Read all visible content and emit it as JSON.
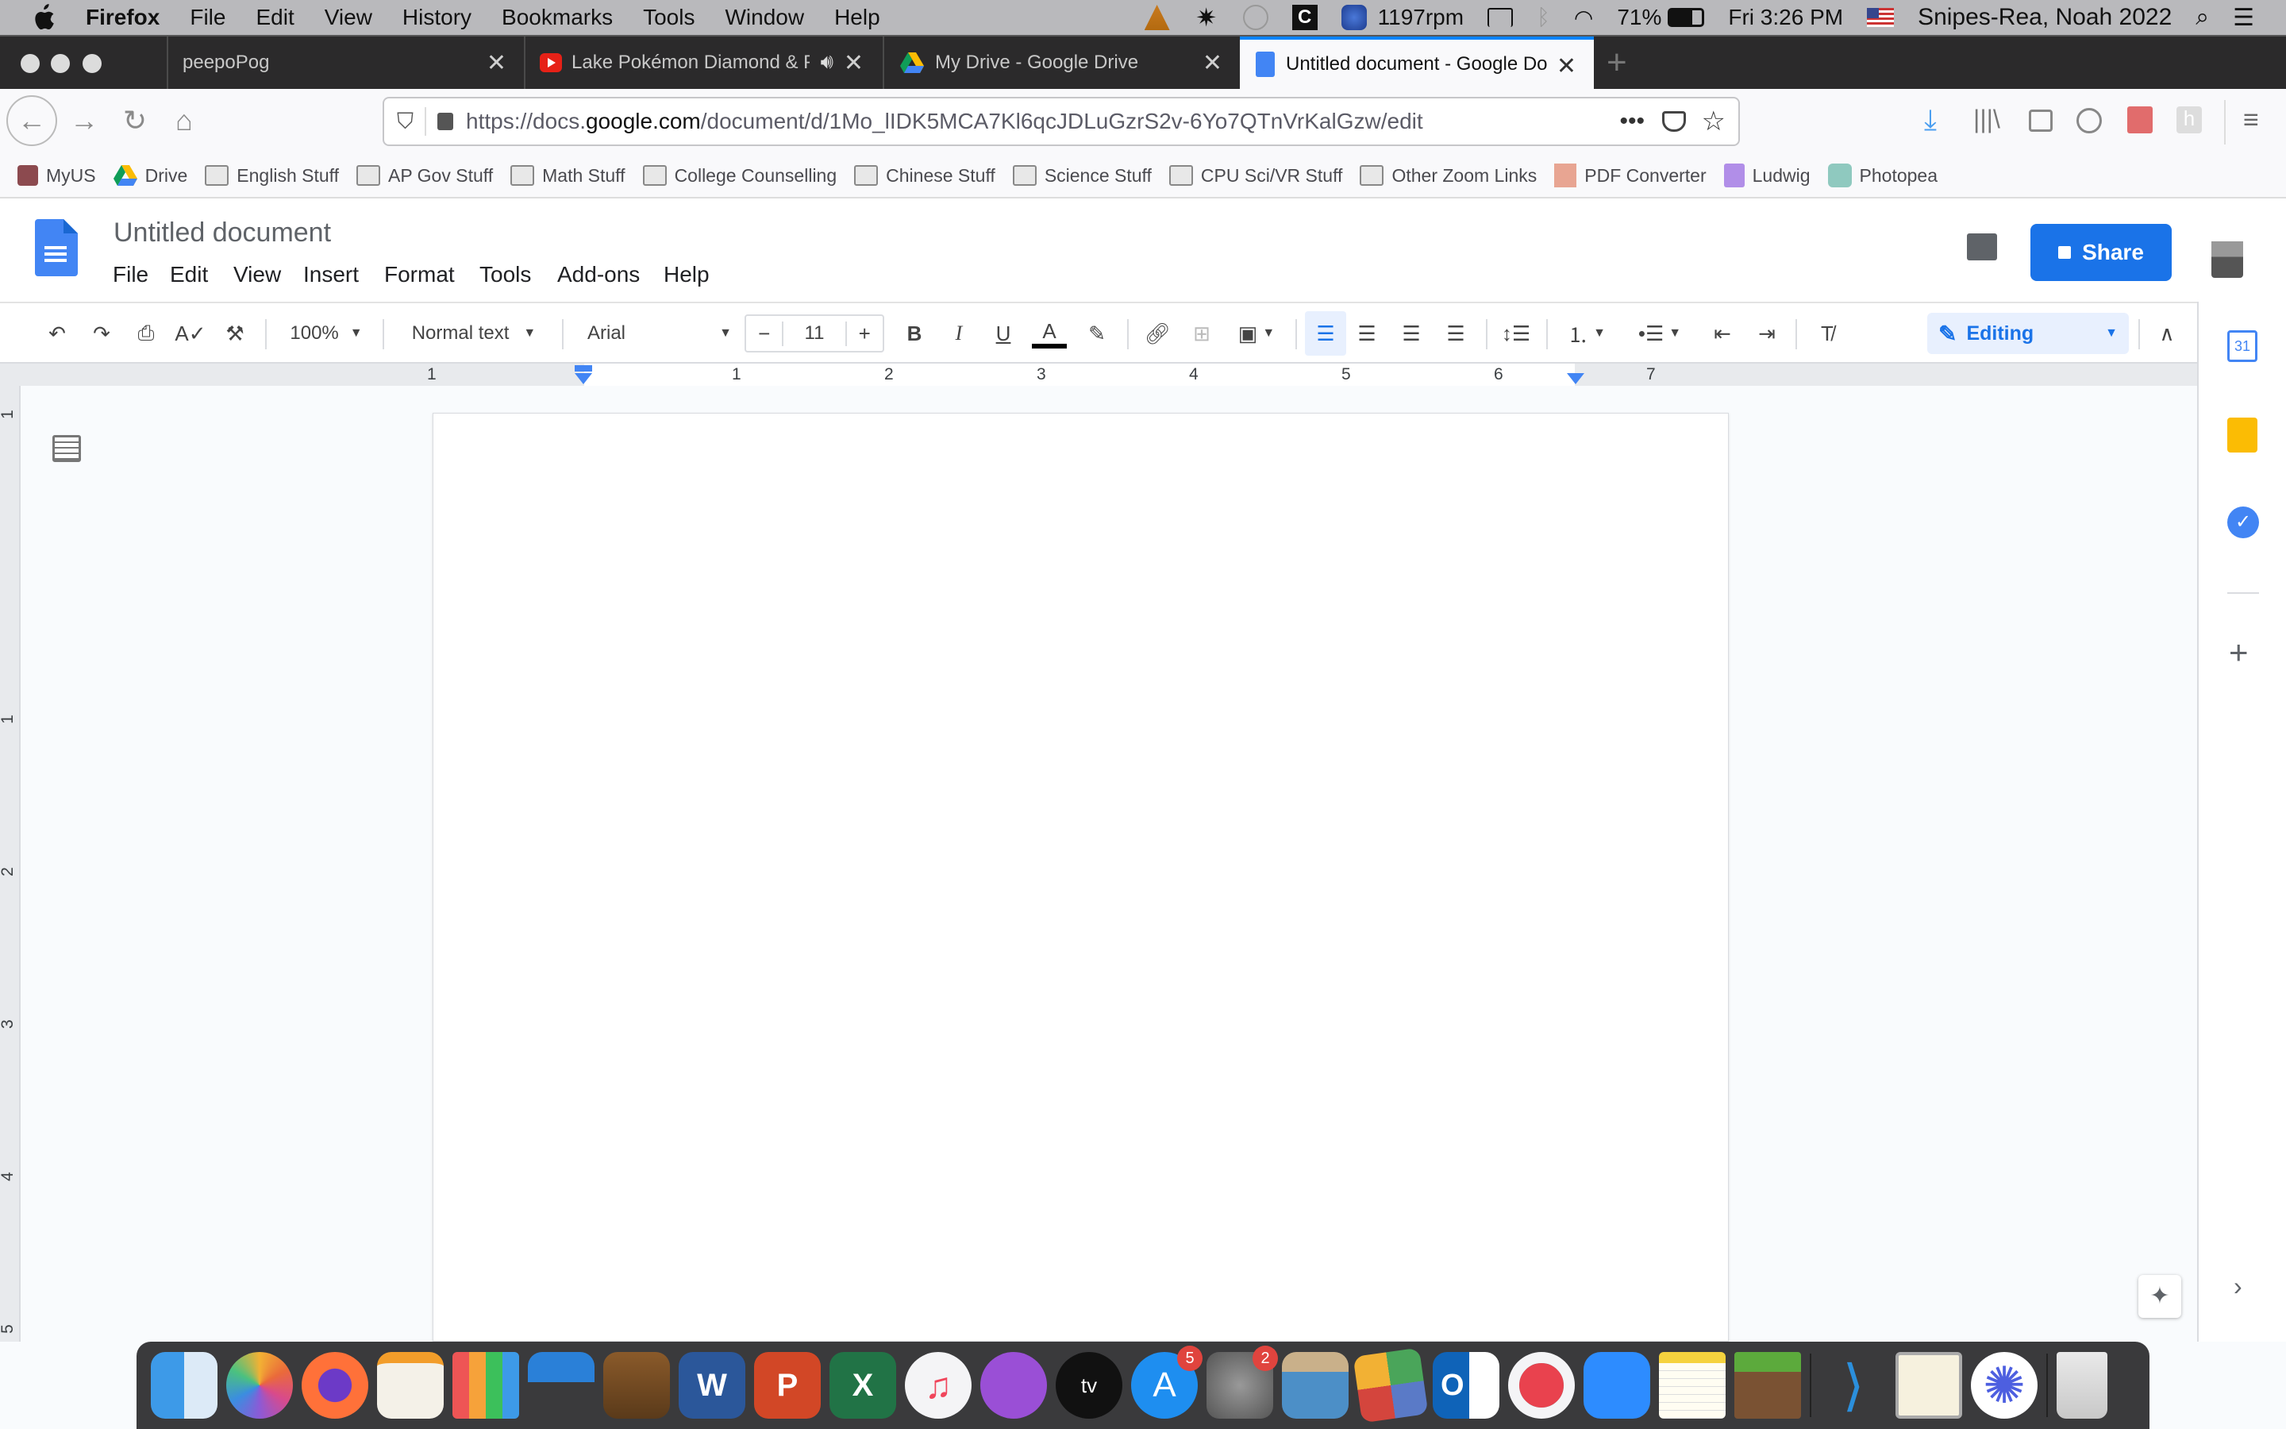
{
  "menubar": {
    "app": "Firefox",
    "items": [
      "File",
      "Edit",
      "View",
      "History",
      "Bookmarks",
      "Tools",
      "Window",
      "Help"
    ],
    "status": {
      "fan_speed": "1197rpm",
      "battery": "71%",
      "clock": "Fri 3:26 PM",
      "user": "Snipes-Rea, Noah 2022"
    }
  },
  "tabs": [
    {
      "title": "peepoPog",
      "icon": "none",
      "active": false
    },
    {
      "title": "Lake Pokémon Diamond & Pearl",
      "icon": "youtube-icon",
      "audio": true,
      "active": false
    },
    {
      "title": "My Drive - Google Drive",
      "icon": "google-drive-icon",
      "active": false
    },
    {
      "title": "Untitled document - Google Docs",
      "icon": "google-docs-icon",
      "active": true
    }
  ],
  "urlbar": {
    "prefix": "https://docs.",
    "domain": "google.com",
    "path": "/document/d/1Mo_lIDK5MCA7Kl6qcJDLuGzrS2v-6Yo7QTnVrKalGzw/edit"
  },
  "bookmarks": [
    {
      "label": "MyUS",
      "icon": "myus-icon"
    },
    {
      "label": "Drive",
      "icon": "google-drive-icon"
    },
    {
      "label": "English Stuff",
      "icon": "folder-icon"
    },
    {
      "label": "AP Gov Stuff",
      "icon": "folder-icon"
    },
    {
      "label": "Math Stuff",
      "icon": "folder-icon"
    },
    {
      "label": "College Counselling",
      "icon": "folder-icon"
    },
    {
      "label": "Chinese Stuff",
      "icon": "folder-icon"
    },
    {
      "label": "Science Stuff",
      "icon": "folder-icon"
    },
    {
      "label": "CPU Sci/VR Stuff",
      "icon": "folder-icon"
    },
    {
      "label": "Other Zoom Links",
      "icon": "folder-icon"
    },
    {
      "label": "PDF Converter",
      "icon": "img-pdf-icon"
    },
    {
      "label": "Ludwig",
      "icon": "twitch-icon"
    },
    {
      "label": "Photopea",
      "icon": "photopea-icon"
    }
  ],
  "docs": {
    "title": "Untitled document",
    "menus": [
      "File",
      "Edit",
      "View",
      "Insert",
      "Format",
      "Tools",
      "Add-ons",
      "Help"
    ],
    "share_label": "Share",
    "toolbar": {
      "zoom": "100%",
      "style": "Normal text",
      "font": "Arial",
      "font_size": "11",
      "mode": "Editing"
    },
    "ruler_numbers": [
      "1",
      "1",
      "2",
      "3",
      "4",
      "5",
      "6",
      "7"
    ],
    "vruler_numbers": [
      "1",
      "1",
      "2",
      "3",
      "4",
      "5"
    ]
  },
  "side_panel": {
    "calendar_day": "31"
  },
  "dock": {
    "apps": [
      {
        "name": "Finder",
        "running": true
      },
      {
        "name": "Photos"
      },
      {
        "name": "Firefox",
        "running": true
      },
      {
        "name": "Pages"
      },
      {
        "name": "Numbers"
      },
      {
        "name": "Keynote"
      },
      {
        "name": "GarageBand"
      },
      {
        "name": "Word"
      },
      {
        "name": "PowerPoint"
      },
      {
        "name": "Excel"
      },
      {
        "name": "Music"
      },
      {
        "name": "Podcasts"
      },
      {
        "name": "TV"
      },
      {
        "name": "App Store",
        "badge": "5"
      },
      {
        "name": "System Preferences",
        "badge": "2"
      },
      {
        "name": "Preview"
      },
      {
        "name": "Self Service"
      },
      {
        "name": "Outlook"
      },
      {
        "name": "News"
      },
      {
        "name": "Zoom"
      },
      {
        "name": "Notes"
      },
      {
        "name": "Minecraft"
      },
      {
        "name": "Visual Studio Code",
        "running": true
      },
      {
        "name": "Console"
      },
      {
        "name": "Scrolling app"
      },
      {
        "name": "Trash"
      }
    ]
  }
}
